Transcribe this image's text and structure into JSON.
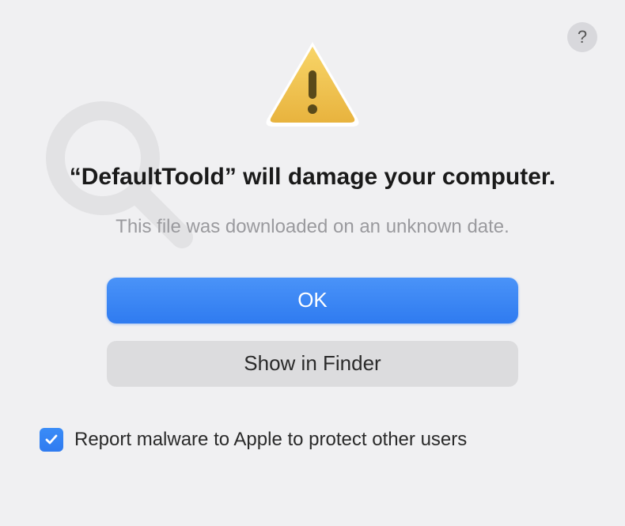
{
  "dialog": {
    "title": "“DefaultToold” will damage your computer.",
    "subtitle": "This file was downloaded on an unknown date.",
    "help_label": "?",
    "primary_button": "OK",
    "secondary_button": "Show in Finder",
    "checkbox_label": "Report malware to Apple to protect other users",
    "checkbox_checked": true
  },
  "icons": {
    "warning": "warning-triangle",
    "help": "question-mark",
    "checkmark": "checkmark"
  },
  "colors": {
    "primary": "#2f7bf0",
    "background": "#f0f0f2",
    "secondary_button": "#dcdcde",
    "text": "#1a1a1a",
    "subtext": "#9a9a9e"
  }
}
